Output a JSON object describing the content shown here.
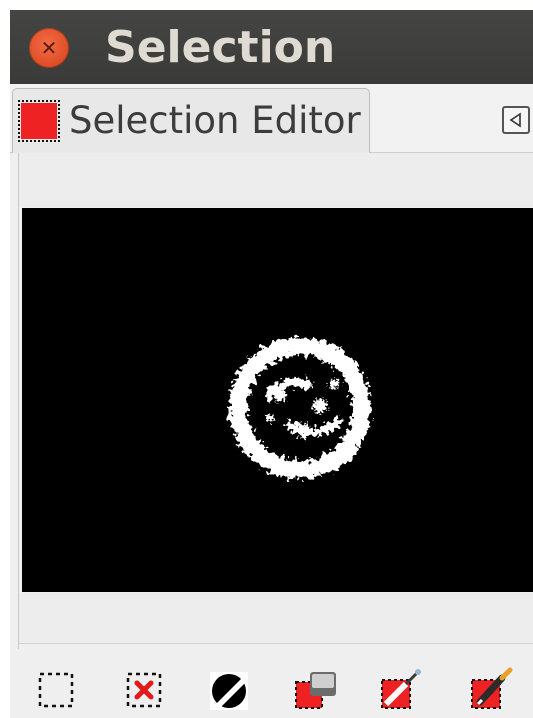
{
  "window": {
    "title": "Selection",
    "close_icon": "close-icon"
  },
  "tab": {
    "label": "Selection Editor",
    "swatch_color": "#ee2222",
    "menu_icon": "tab-menu-arrow-icon"
  },
  "preview": {
    "background": "#000000",
    "content": "selection-mask-preview"
  },
  "toolbar": {
    "buttons": [
      {
        "icon": "select-all-icon"
      },
      {
        "icon": "select-none-icon"
      },
      {
        "icon": "invert-selection-icon"
      },
      {
        "icon": "save-to-channel-icon"
      },
      {
        "icon": "stroke-selection-icon"
      },
      {
        "icon": "stroke-with-paint-tool-icon"
      }
    ]
  }
}
